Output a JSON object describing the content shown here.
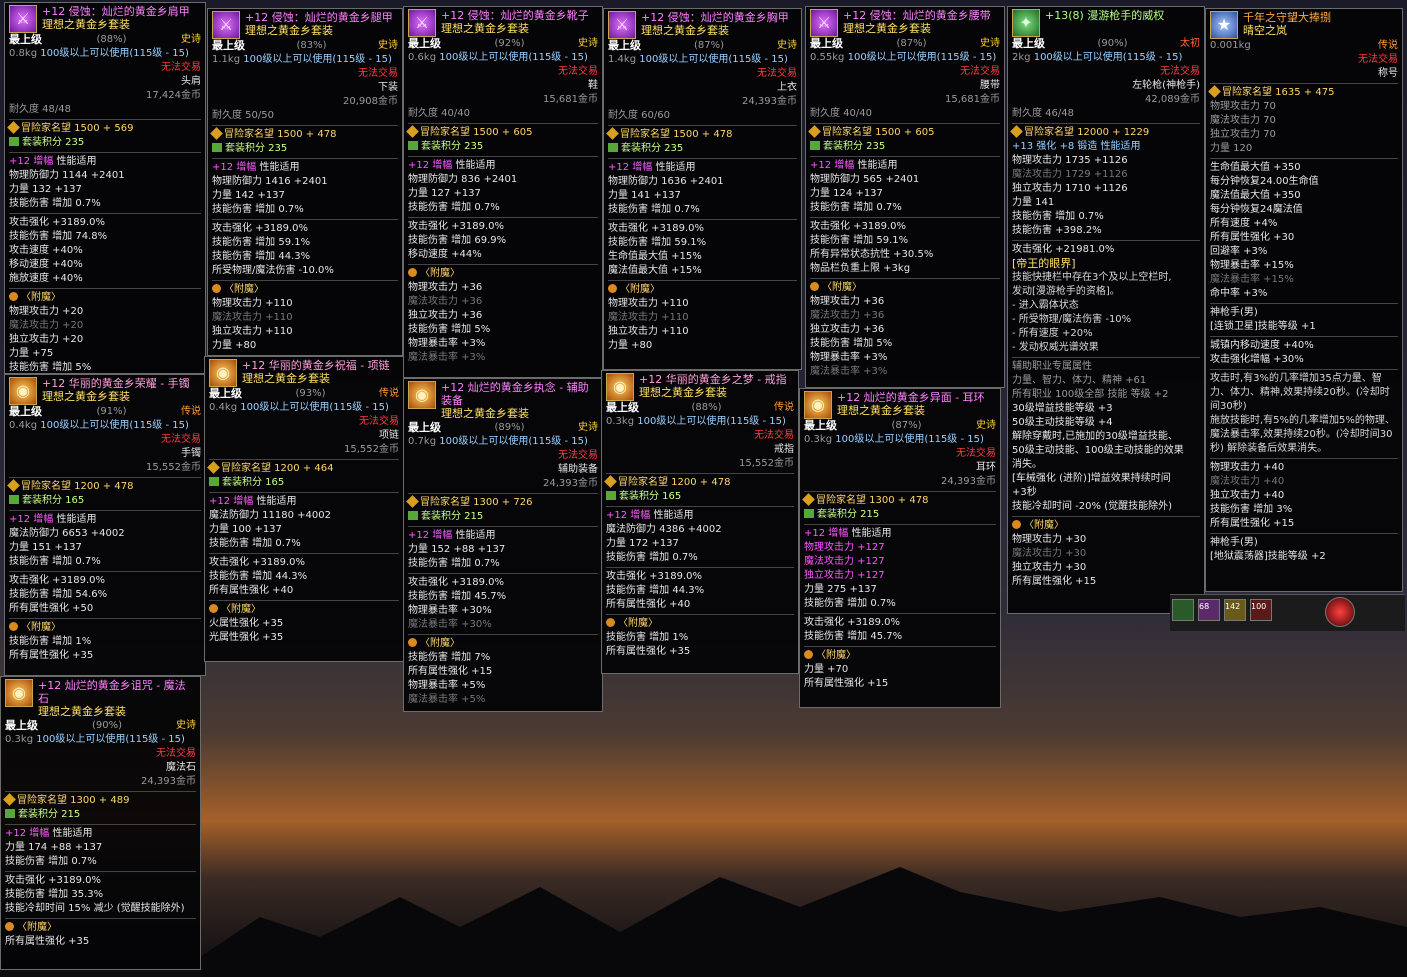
{
  "items": [
    {
      "id": "shoulder",
      "name": "+12 侵蚀：灿烂的黄金乡肩甲",
      "set": "理想之黄金乡套装",
      "grade": "最上级",
      "grade_pct": "(88%)",
      "rarity": "史诗",
      "weight": "0.8kg",
      "level": "100级以上可以使用(115级 - 15)",
      "trade": "无法交易",
      "type": "头肩",
      "price": "17,424金币",
      "durability": "耐久度 48/48",
      "fame": "冒险家名望 1500 + 569",
      "setpoint": "套装积分 235",
      "amp_title": "+12 增幅",
      "amp_sub": "性能适用",
      "lines": [
        "物理防御力 1144 +2401",
        "力量 132 +137",
        "技能伤害 增加 0.7%",
        "攻击强化 +3189.0%",
        "技能伤害 增加 74.8%",
        "攻击速度 +40%",
        "移动速度 +40%",
        "施放速度 +40%"
      ],
      "ench_title": "〈附魔〉",
      "ench": [
        "物理攻击力 +20",
        "魔法攻击力 +20",
        "独立攻击力 +20",
        "力量 +75",
        "技能伤害 增加 5%"
      ]
    },
    {
      "id": "chest",
      "name": "+12 侵蚀：灿烂的黄金乡腿甲",
      "set": "理想之黄金乡套装",
      "grade": "最上级",
      "grade_pct": "(83%)",
      "rarity": "史诗",
      "weight": "1.1kg",
      "level": "100级以上可以使用(115级 - 15)",
      "trade": "无法交易",
      "type": "下装",
      "price": "20,908金币",
      "durability": "耐久度 50/50",
      "fame": "冒险家名望 1500 + 478",
      "setpoint": "套装积分 235",
      "amp_title": "+12 增幅",
      "amp_sub": "性能适用",
      "lines": [
        "物理防御力 1416 +2401",
        "力量 142 +137",
        "技能伤害 增加 0.7%",
        "攻击强化 +3189.0%",
        "技能伤害 增加 59.1%",
        "技能伤害 增加 44.3%",
        "所受物理/魔法伤害 -10.0%"
      ],
      "ench_title": "〈附魔〉",
      "ench": [
        "物理攻击力 +110",
        "魔法攻击力 +110",
        "独立攻击力 +110",
        "力量 +80"
      ]
    },
    {
      "id": "shoes",
      "name": "+12 侵蚀：灿烂的黄金乡靴子",
      "set": "理想之黄金乡套装",
      "grade": "最上级",
      "grade_pct": "(92%)",
      "rarity": "史诗",
      "weight": "0.6kg",
      "level": "100级以上可以使用(115级 - 15)",
      "trade": "无法交易",
      "type": "鞋",
      "price": "15,681金币",
      "durability": "耐久度 40/40",
      "fame": "冒险家名望 1500 + 605",
      "setpoint": "套装积分 235",
      "amp_title": "+12 增幅",
      "amp_sub": "性能适用",
      "lines": [
        "物理防御力 836 +2401",
        "力量 127 +137",
        "技能伤害 增加 0.7%",
        "攻击强化 +3189.0%",
        "技能伤害 增加 69.9%",
        "移动速度 +44%"
      ],
      "ench_title": "〈附魔〉",
      "ench": [
        "物理攻击力 +36",
        "魔法攻击力 +36",
        "独立攻击力 +36",
        "技能伤害 增加 5%",
        "物理暴击率 +3%",
        "魔法暴击率 +3%"
      ]
    },
    {
      "id": "top",
      "name": "+12 侵蚀：灿烂的黄金乡胸甲",
      "set": "理想之黄金乡套装",
      "grade": "最上级",
      "grade_pct": "(87%)",
      "rarity": "史诗",
      "weight": "1.4kg",
      "level": "100级以上可以使用(115级 - 15)",
      "trade": "无法交易",
      "type": "上衣",
      "price": "24,393金币",
      "durability": "耐久度 60/60",
      "fame": "冒险家名望 1500 + 478",
      "setpoint": "套装积分 235",
      "amp_title": "+12 增幅",
      "amp_sub": "性能适用",
      "lines": [
        "物理防御力 1636 +2401",
        "力量 141 +137",
        "技能伤害 增加 0.7%",
        "攻击强化 +3189.0%",
        "技能伤害 增加 59.1%",
        "生命值最大值 +15%",
        "魔法值最大值 +15%"
      ],
      "ench_title": "〈附魔〉",
      "ench": [
        "物理攻击力 +110",
        "魔法攻击力 +110",
        "独立攻击力 +110",
        "力量 +80"
      ]
    },
    {
      "id": "belt",
      "name": "+12 侵蚀：灿烂的黄金乡腰带",
      "set": "理想之黄金乡套装",
      "grade": "最上级",
      "grade_pct": "(87%)",
      "rarity": "史诗",
      "weight": "0.55kg",
      "level": "100级以上可以使用(115级 - 15)",
      "trade": "无法交易",
      "type": "腰带",
      "price": "15,681金币",
      "durability": "耐久度 40/40",
      "fame": "冒险家名望 1500 + 605",
      "setpoint": "套装积分 235",
      "amp_title": "+12 增幅",
      "amp_sub": "性能适用",
      "lines": [
        "物理防御力 565 +2401",
        "力量 124 +137",
        "技能伤害 增加 0.7%",
        "攻击强化 +3189.0%",
        "技能伤害 增加 59.1%",
        "所有异常状态抗性 +30.5%",
        "物品栏负重上限 +3kg"
      ],
      "ench_title": "〈附魔〉",
      "ench": [
        "物理攻击力 +36",
        "魔法攻击力 +36",
        "独立攻击力 +36",
        "技能伤害 增加 5%",
        "物理暴击率 +3%",
        "魔法暴击率 +3%"
      ]
    },
    {
      "id": "bracelet",
      "name": "+12 华丽的黄金乡荣耀 - 手镯",
      "set": "理想之黄金乡套装",
      "grade": "最上级",
      "grade_pct": "(91%)",
      "rarity": "传说",
      "weight": "0.4kg",
      "level": "100级以上可以使用(115级 - 15)",
      "trade": "无法交易",
      "type": "手镯",
      "price": "15,552金币",
      "fame": "冒险家名望 1200 + 478",
      "setpoint": "套装积分 165",
      "amp_title": "+12 增幅",
      "amp_sub": "性能适用",
      "lines": [
        "魔法防御力 6653 +4002",
        "力量 151 +137",
        "技能伤害 增加 0.7%",
        "攻击强化 +3189.0%",
        "技能伤害 增加 54.6%",
        "所有属性强化 +50"
      ],
      "ench_title": "〈附魔〉",
      "ench": [
        "技能伤害 增加 1%",
        "所有属性强化 +35"
      ]
    },
    {
      "id": "necklace",
      "name": "+12 华丽的黄金乡祝福 - 项链",
      "set": "理想之黄金乡套装",
      "grade": "最上级",
      "grade_pct": "(93%)",
      "rarity": "传说",
      "weight": "0.4kg",
      "level": "100级以上可以使用(115级 - 15)",
      "trade": "无法交易",
      "type": "项链",
      "price": "15,552金币",
      "fame": "冒险家名望 1200 + 464",
      "setpoint": "套装积分 165",
      "amp_title": "+12 增幅",
      "amp_sub": "性能适用",
      "lines": [
        "魔法防御力 11180 +4002",
        "力量 100 +137",
        "技能伤害 增加 0.7%",
        "攻击强化 +3189.0%",
        "技能伤害 增加 44.3%",
        "所有属性强化 +40"
      ],
      "ench_title": "〈附魔〉",
      "ench": [
        "火属性强化 +35",
        "光属性强化 +35"
      ]
    },
    {
      "id": "support",
      "name": "+12 灿烂的黄金乡执念 - 辅助装备",
      "set": "理想之黄金乡套装",
      "grade": "最上级",
      "grade_pct": "(89%)",
      "rarity": "史诗",
      "weight": "0.7kg",
      "level": "100级以上可以使用(115级 - 15)",
      "trade": "无法交易",
      "type": "辅助装备",
      "price": "24,393金币",
      "fame": "冒险家名望 1300 + 726",
      "setpoint": "套装积分 215",
      "amp_title": "+12 增幅",
      "amp_sub": "性能适用",
      "lines": [
        "力量 152 +88 +137",
        "技能伤害 增加 0.7%",
        "攻击强化 +3189.0%",
        "技能伤害 增加 45.7%",
        "物理暴击率 +30%",
        "魔法暴击率 +30%"
      ],
      "ench_title": "〈附魔〉",
      "ench": [
        "技能伤害 增加 7%",
        "所有属性强化 +15",
        "物理暴击率 +5%",
        "魔法暴击率 +5%"
      ]
    },
    {
      "id": "ring",
      "name": "+12 华丽的黄金乡之梦 - 戒指",
      "set": "理想之黄金乡套装",
      "grade": "最上级",
      "grade_pct": "(88%)",
      "rarity": "传说",
      "weight": "0.3kg",
      "level": "100级以上可以使用(115级 - 15)",
      "trade": "无法交易",
      "type": "戒指",
      "price": "15,552金币",
      "fame": "冒险家名望 1200 + 478",
      "setpoint": "套装积分 165",
      "amp_title": "+12 增幅",
      "amp_sub": "性能适用",
      "lines": [
        "魔法防御力 4386 +4002",
        "力量 172 +137",
        "技能伤害 增加 0.7%",
        "攻击强化 +3189.0%",
        "技能伤害 增加 44.3%",
        "所有属性强化 +40"
      ],
      "ench_title": "〈附魔〉",
      "ench": [
        "技能伤害 增加 1%",
        "所有属性强化 +35"
      ]
    },
    {
      "id": "earring",
      "name": "+12 灿烂的黄金乡异面 - 耳环",
      "set": "理想之黄金乡套装",
      "grade": "最上级",
      "grade_pct": "(87%)",
      "rarity": "史诗",
      "weight": "0.3kg",
      "level": "100级以上可以使用(115级 - 15)",
      "trade": "无法交易",
      "type": "耳环",
      "price": "24,393金币",
      "fame": "冒险家名望 1300 + 478",
      "setpoint": "套装积分 215",
      "amp_title": "+12 增幅",
      "amp_sub": "性能适用",
      "lines": [
        "物理攻击力 +127",
        "魔法攻击力 +127",
        "独立攻击力 +127",
        "力量 275 +137",
        "技能伤害 增加 0.7%",
        "攻击强化 +3189.0%",
        "技能伤害 增加 45.7%"
      ],
      "ench_title": "〈附魔〉",
      "ench": [
        "力量 +70",
        "所有属性强化 +15"
      ]
    },
    {
      "id": "magicstone",
      "name": "+12 灿烂的黄金乡诅咒 - 魔法石",
      "set": "理想之黄金乡套装",
      "grade": "最上级",
      "grade_pct": "(90%)",
      "rarity": "史诗",
      "weight": "0.3kg",
      "level": "100级以上可以使用(115级 - 15)",
      "trade": "无法交易",
      "type": "魔法石",
      "price": "24,393金币",
      "fame": "冒险家名望 1300 + 489",
      "setpoint": "套装积分 215",
      "amp_title": "+12 增幅",
      "amp_sub": "性能适用",
      "lines": [
        "力量 174 +88 +137",
        "技能伤害 增加 0.7%",
        "攻击强化 +3189.0%",
        "技能伤害 增加 35.3%",
        "技能冷却时间 15% 减少 (觉醒技能除外)"
      ],
      "ench_title": "〈附魔〉",
      "ench": [
        "所有属性强化 +35"
      ]
    }
  ],
  "weapon": {
    "name": "+13(8) 漫游枪手的威权",
    "grade": "最上级",
    "grade_pct": "(90%)",
    "rarity": "太初",
    "weight": "2kg",
    "level": "100级以上可以使用(115级 - 15)",
    "trade": "无法交易",
    "type": "左轮枪(神枪手)",
    "price": "42,089金币",
    "durability": "耐久度 46/48",
    "fame": "冒险家名望 12000 + 1229",
    "enhance": "+13 强化 +8 锻造 性能适用",
    "lines": [
      "物理攻击力 1735 +1126",
      "魔法攻击力 1729 +1126",
      "独立攻击力 1710 +1126",
      "力量 141",
      "技能伤害 增加 0.7%",
      "技能伤害 +398.2%",
      "攻击强化 +21981.0%"
    ],
    "option_title": "[帝王的眼界]",
    "option": [
      "技能快捷栏中存在3个及以上空栏时,",
      "发动[漫游枪手的资格]。",
      "- 进入霸体状态",
      "- 所受物理/魔法伤害 -10%",
      "- 所有速度 +20%",
      "- 发动权威光谱效果"
    ],
    "aux_title": "辅助职业专属属性",
    "aux": [
      "力量、智力、体力、精神 +61",
      "所有职业 100级全部 技能 等级 +2",
      "30级增益技能等级 +3",
      "50级主动技能等级 +4",
      "解除穿戴时,已施加的30级增益技能、",
      "50级主动技能、100级主动技能的效果",
      "消失。",
      "[车械强化 (进阶)]增益效果持续时间",
      "+3秒",
      "技能冷却时间 -20% (觉醒技能除外)"
    ],
    "ench_title": "〈附魔〉",
    "ench": [
      "物理攻击力 +30",
      "魔法攻击力 +30",
      "独立攻击力 +30",
      "所有属性强化 +15"
    ]
  },
  "title_item": {
    "name": "千年之守望大捧捌",
    "subname": "晴空之岚",
    "weight": "0.001kg",
    "rarity": "传说",
    "trade": "无法交易",
    "type": "称号",
    "fame": "冒险家名望 1635 + 475",
    "lines": [
      "物理攻击力 70",
      "魔法攻击力 70",
      "独立攻击力 70",
      "力量 120",
      "生命值最大值 +350",
      "每分钟恢复24.00生命值",
      "魔法值最大值 +350",
      "每分钟恢复24魔法值",
      "所有速度 +4%",
      "所有属性强化 +30",
      "回避率 +3%",
      "物理暴击率 +15%",
      "魔法暴击率 +15%",
      "命中率 +3%"
    ],
    "class1": "神枪手(男)",
    "class1_skill": "[连锁卫星]技能等级 +1",
    "town": "城镇内移动速度 +40%",
    "atk": "攻击强化增幅 +30%",
    "proc": "攻击时,有3%的几率增加35点力量、智力、体力、精神,效果持续20秒。(冷却时间30秒)",
    "proc2": "施放技能时,有5%的几率增加5%的物理、魔法暴击率,效果持续20秒。(冷却时间30秒) 解除装备后效果消失。",
    "ench": [
      "物理攻击力 +40",
      "魔法攻击力 +40",
      "独立攻击力 +40",
      "技能伤害 增加 3%",
      "所有属性强化 +15"
    ],
    "class2": "神枪手(男)",
    "class2_skill": "[地狱震荡器]技能等级 +2"
  },
  "hud": {
    "a": "68",
    "b": "142",
    "c": "100"
  },
  "icons": {
    "armor": "sword-glyph",
    "accessory": "gold-orb",
    "weapon": "gun-glyph",
    "title": "badge-glyph"
  },
  "colors": {
    "name_pink": "#ff80ff",
    "set_yellow": "#ffe066",
    "amp": "#ff5aff",
    "red": "#ff3a3a"
  }
}
